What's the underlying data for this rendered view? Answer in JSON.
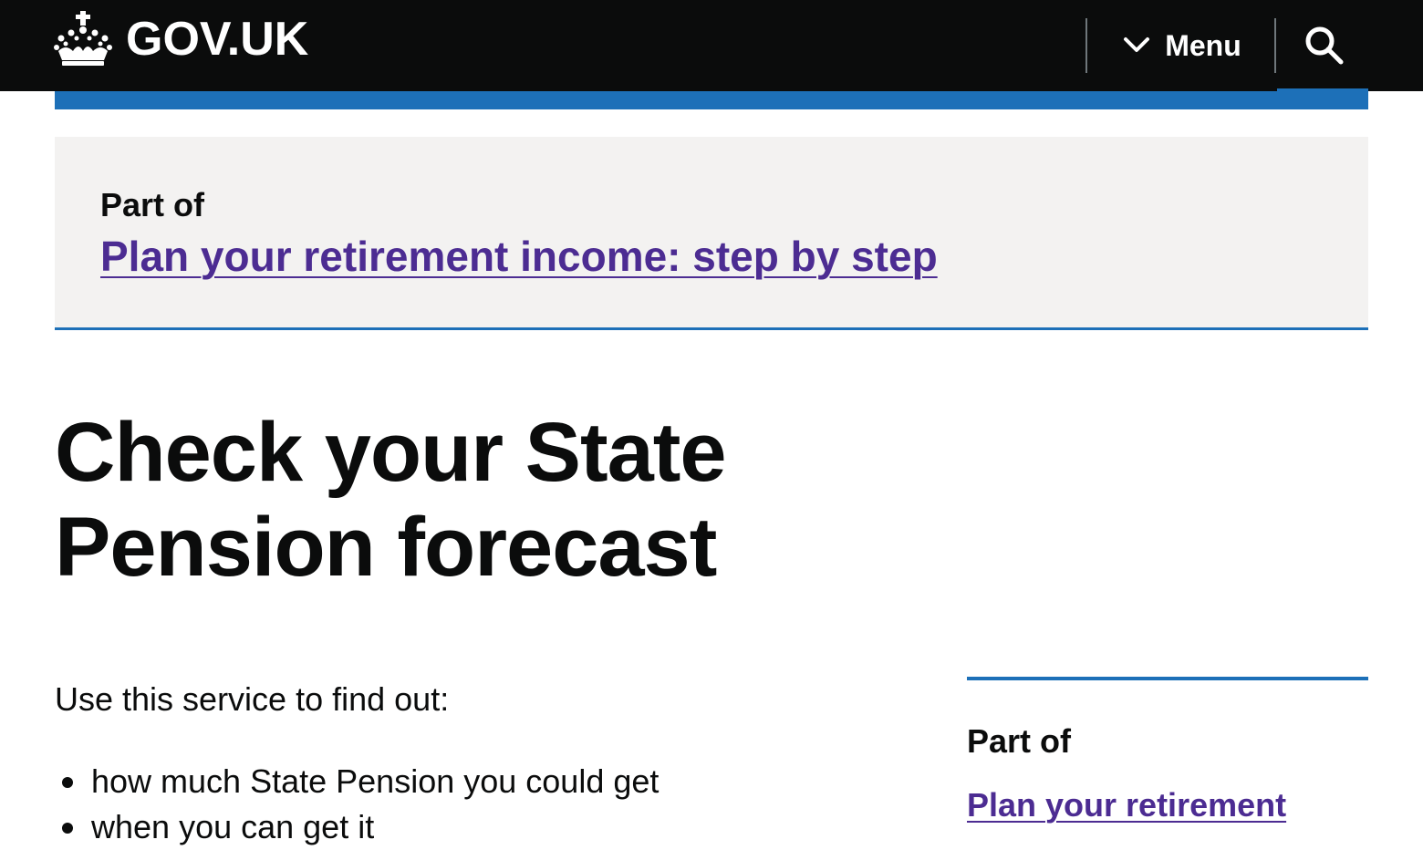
{
  "header": {
    "logo_text": "GOV.UK",
    "menu_label": "Menu",
    "search_icon": "search-icon",
    "colors": {
      "background": "#0b0c0c",
      "accent": "#1d70b8"
    }
  },
  "step_by_step": {
    "part_of_label": "Part of",
    "link_text": "Plan your retirement income: step by step",
    "link_color": "#4c2c92"
  },
  "main": {
    "title_line1": "Check your State",
    "title_line2": "Pension forecast",
    "intro": "Use this service to find out:",
    "bullets": [
      "how much State Pension you could get",
      "when you can get it"
    ]
  },
  "sidebar": {
    "part_of_label": "Part of",
    "link_text": "Plan your retirement"
  }
}
